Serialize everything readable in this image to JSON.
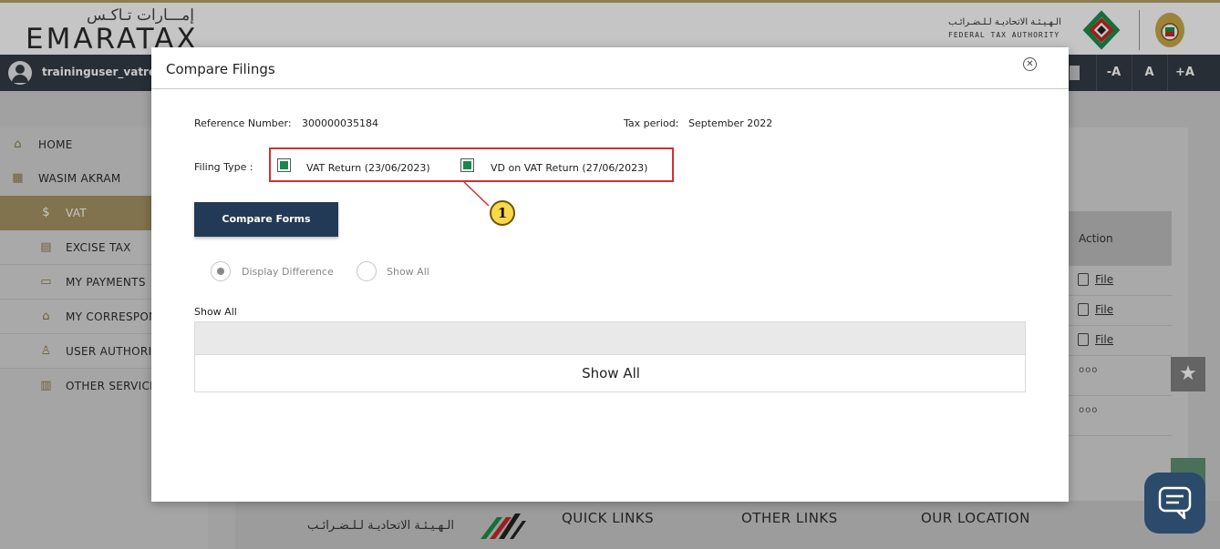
{
  "header": {
    "logo_ar": "إمـــارات تـاكـس",
    "logo_en": "EMARATAX",
    "fta_ar": "الـهـيـئـة الاتحاديـة لـلـضـرائـب",
    "fta_en": "FEDERAL TAX AUTHORITY"
  },
  "userbar": {
    "username": "traininguser_vatretu",
    "font_controls": [
      "-A",
      "A",
      "+A"
    ]
  },
  "sidebar": {
    "items": [
      {
        "label": "HOME",
        "icon": "home-icon"
      },
      {
        "label": "WASIM AKRAM",
        "icon": "grid-icon"
      },
      {
        "label": "VAT",
        "icon": "money-bag-icon",
        "active": true
      },
      {
        "label": "EXCISE TAX",
        "icon": "excise-icon"
      },
      {
        "label": "MY PAYMENTS",
        "icon": "payments-icon"
      },
      {
        "label": "MY CORRESPON",
        "icon": "bank-icon"
      },
      {
        "label": "USER AUTHORIZ",
        "icon": "user-auth-icon"
      },
      {
        "label": "OTHER SERVICE",
        "icon": "services-icon"
      }
    ]
  },
  "background_table": {
    "action_header": "Action",
    "rows": [
      "File",
      "File",
      "File",
      "ooo",
      "ooo"
    ]
  },
  "footer": {
    "fta_ar": "الـهـيـئـة الاتحاديـة لـلـضـرائـب",
    "links": [
      "QUICK LINKS",
      "OTHER LINKS",
      "OUR LOCATION"
    ]
  },
  "modal": {
    "title": "Compare Filings",
    "reference_label": "Reference Number:",
    "reference_value": "300000035184",
    "period_label": "Tax period:",
    "period_value": "September 2022",
    "filing_type_label": "Filing Type :",
    "filings": [
      {
        "label": "VAT Return (23/06/2023)",
        "checked": true
      },
      {
        "label": "VD on VAT Return (27/06/2023)",
        "checked": true
      }
    ],
    "callout_number": "1",
    "compare_button": "Compare Forms",
    "radio_options": [
      {
        "label": "Display Difference",
        "selected": true
      },
      {
        "label": "Show All",
        "selected": false
      }
    ],
    "section_label": "Show All",
    "show_all_text": "Show All"
  },
  "colors": {
    "accent_gold": "#a69463",
    "navy": "#233a56",
    "highlight_red": "#d32f2f",
    "check_green": "#138a4c",
    "callout_yellow": "#f7d84a"
  }
}
